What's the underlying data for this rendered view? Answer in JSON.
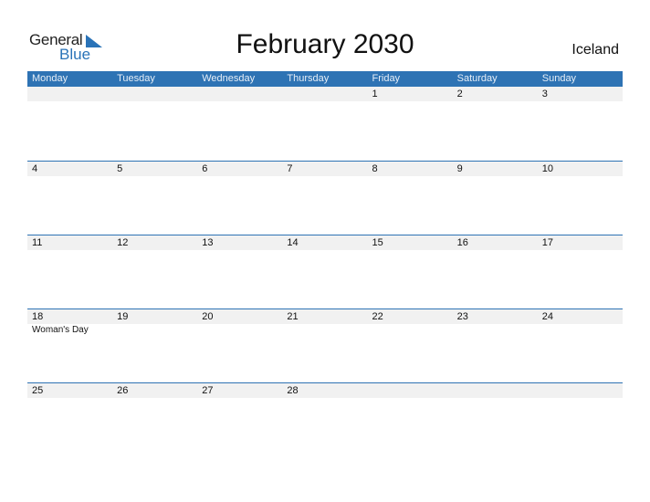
{
  "logo": {
    "general": "General",
    "blue": "Blue"
  },
  "title": "February 2030",
  "country": "Iceland",
  "accent_color": "#2e73b4",
  "weekdays": [
    "Monday",
    "Tuesday",
    "Wednesday",
    "Thursday",
    "Friday",
    "Saturday",
    "Sunday"
  ],
  "weeks": [
    {
      "days": [
        "",
        "",
        "",
        "",
        "1",
        "2",
        "3"
      ],
      "events": [
        "",
        "",
        "",
        "",
        "",
        "",
        ""
      ]
    },
    {
      "days": [
        "4",
        "5",
        "6",
        "7",
        "8",
        "9",
        "10"
      ],
      "events": [
        "",
        "",
        "",
        "",
        "",
        "",
        ""
      ]
    },
    {
      "days": [
        "11",
        "12",
        "13",
        "14",
        "15",
        "16",
        "17"
      ],
      "events": [
        "",
        "",
        "",
        "",
        "",
        "",
        ""
      ]
    },
    {
      "days": [
        "18",
        "19",
        "20",
        "21",
        "22",
        "23",
        "24"
      ],
      "events": [
        "Woman's Day",
        "",
        "",
        "",
        "",
        "",
        ""
      ]
    },
    {
      "days": [
        "25",
        "26",
        "27",
        "28",
        "",
        "",
        ""
      ],
      "events": [
        "",
        "",
        "",
        "",
        "",
        "",
        ""
      ]
    }
  ]
}
